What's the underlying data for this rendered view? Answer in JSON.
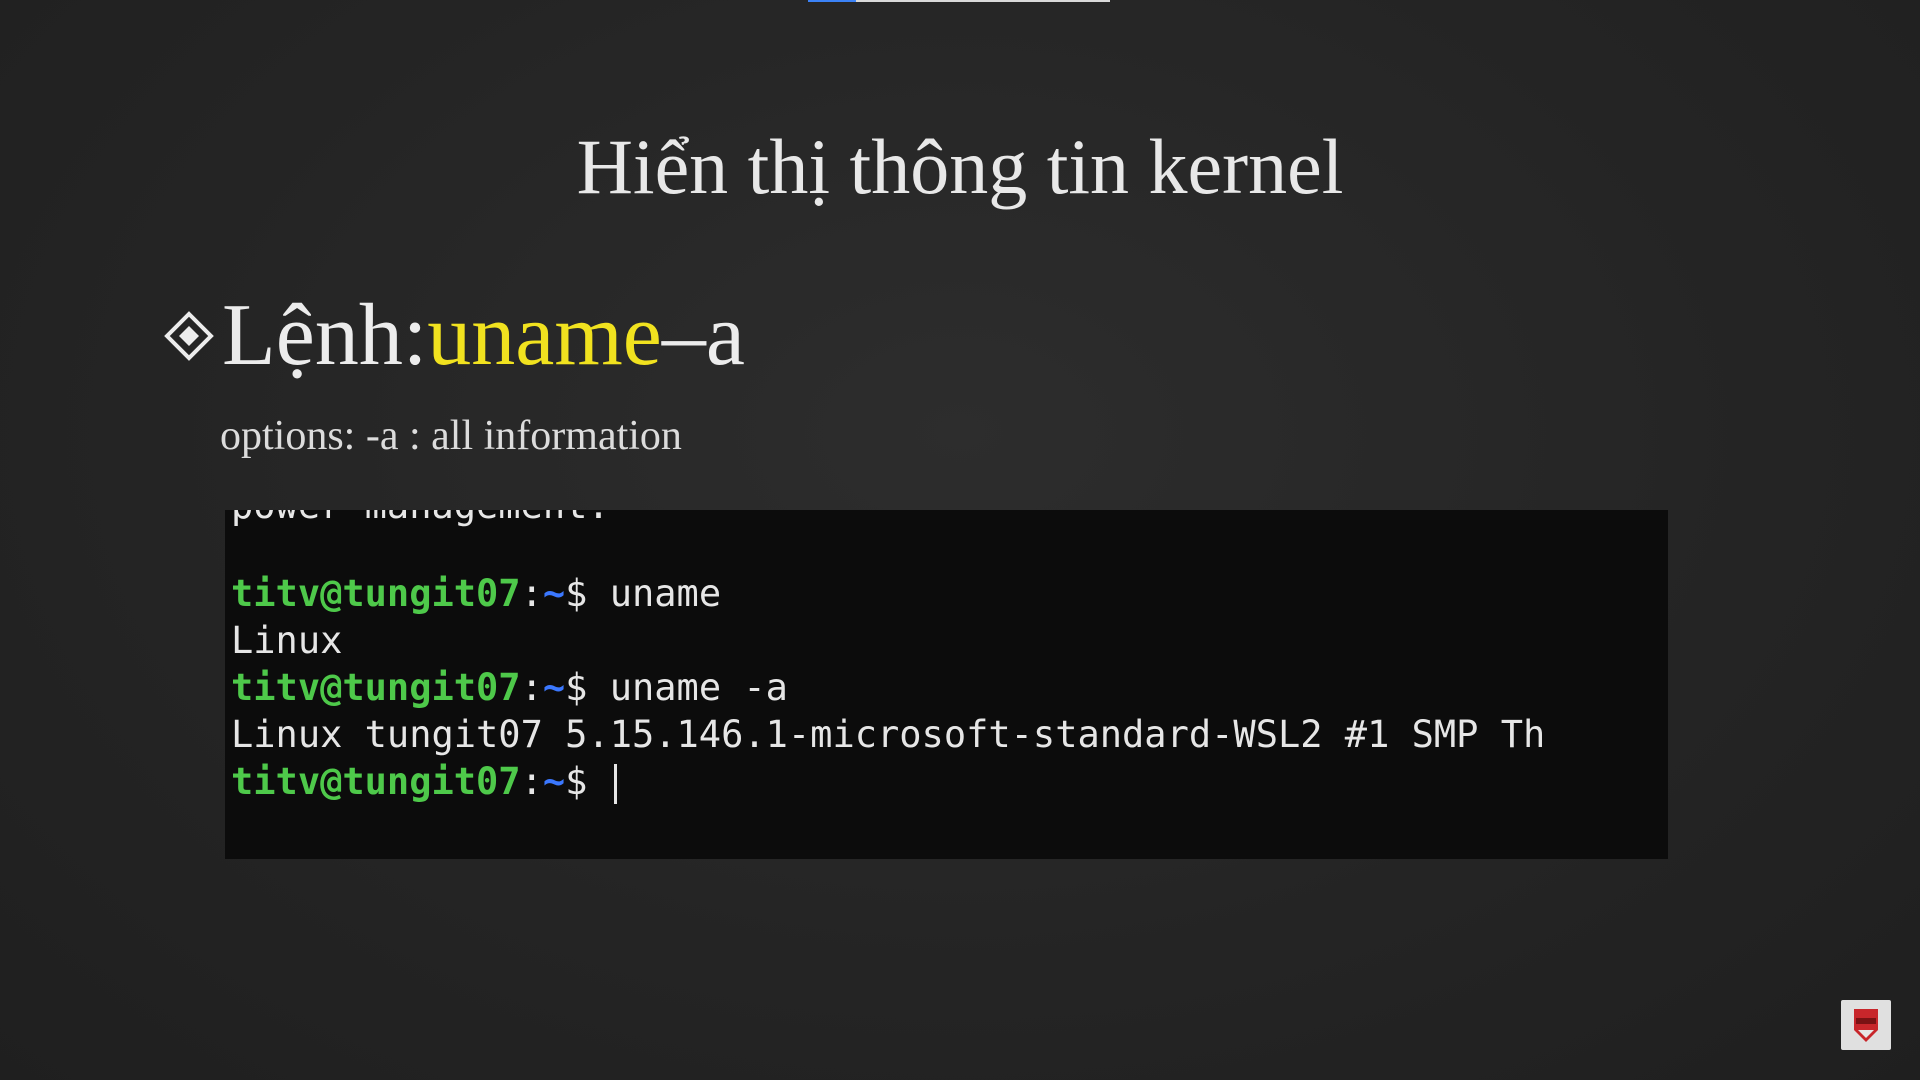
{
  "slide": {
    "title": "Hiển thị thông tin kernel",
    "bullet": {
      "label": "Lệnh: ",
      "command": "uname",
      "flag": " –a"
    },
    "options": "options: -a : all information"
  },
  "terminal": {
    "clipped_top_line": "power management:",
    "prompt": {
      "user_host": "titv@tungit07",
      "colon": ":",
      "path": "~",
      "dollar": "$"
    },
    "lines": [
      {
        "type": "command",
        "text": " uname"
      },
      {
        "type": "output",
        "text": "Linux"
      },
      {
        "type": "command",
        "text": " uname -a"
      },
      {
        "type": "output",
        "text": "Linux tungit07 5.15.146.1-microsoft-standard-WSL2 #1 SMP Th"
      },
      {
        "type": "command",
        "text": " "
      }
    ]
  },
  "video": {
    "progress_fraction": 0.16
  },
  "colors": {
    "highlight": "#f1e21f",
    "prompt_user": "#4ec94a",
    "prompt_path": "#3b78ff",
    "terminal_bg": "#0c0c0c"
  },
  "icons": {
    "bullet": "diamond-bullet-icon",
    "logo": "channel-logo-icon"
  }
}
